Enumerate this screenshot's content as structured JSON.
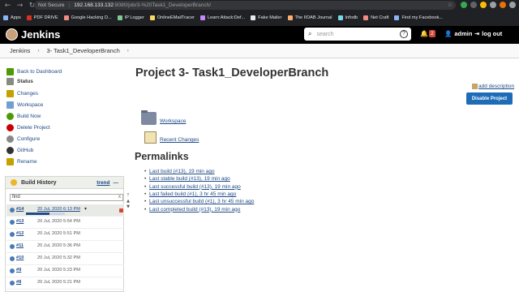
{
  "browser": {
    "security_label": "Not Secure",
    "url_host": "192.168.133.132",
    "url_path": ":8080/job/3-%20Task1_DeveloperBranch/",
    "bookmarks": [
      {
        "label": "Apps",
        "color": "#8ab4f8"
      },
      {
        "label": "PDF DRIVE",
        "color": "#d93025"
      },
      {
        "label": "Google Hacking D...",
        "color": "#f28b82"
      },
      {
        "label": "IP Logger",
        "color": "#81c995"
      },
      {
        "label": "OnlineEMailTracer",
        "color": "#fdd663"
      },
      {
        "label": "Learn:Attack:Def...",
        "color": "#c58af9"
      },
      {
        "label": "Fake Mailer",
        "color": "#e8eaed"
      },
      {
        "label": "The IIOAB Journal",
        "color": "#fcad70"
      },
      {
        "label": "Infodb",
        "color": "#78d9ec"
      },
      {
        "label": "Net Craft",
        "color": "#f28b82"
      },
      {
        "label": "Find my Facebook...",
        "color": "#8ab4f8"
      }
    ]
  },
  "header": {
    "title": "Jenkins",
    "search_placeholder": "search",
    "notifications": "2",
    "user": "admin",
    "logout": "log out"
  },
  "breadcrumb": {
    "root": "Jenkins",
    "current": "3- Task1_DeveloperBranch"
  },
  "tasks": [
    {
      "label": "Back to Dashboard",
      "icon": "arrow-up-icon",
      "color": "#4e9a06"
    },
    {
      "label": "Status",
      "icon": "magnifier-icon",
      "color": "#888a85"
    },
    {
      "label": "Changes",
      "icon": "notepad-icon",
      "color": "#c4a000"
    },
    {
      "label": "Workspace",
      "icon": "folder-icon",
      "color": "#729fcf"
    },
    {
      "label": "Build Now",
      "icon": "clock-icon",
      "color": "#4e9a06"
    },
    {
      "label": "Delete Project",
      "icon": "no-entry-icon",
      "color": "#cc0000"
    },
    {
      "label": "Configure",
      "icon": "gear-icon",
      "color": "#888a85"
    },
    {
      "label": "GitHub",
      "icon": "github-icon",
      "color": "#333333"
    },
    {
      "label": "Rename",
      "icon": "notepad-icon",
      "color": "#c4a000"
    }
  ],
  "build_history": {
    "title": "Build History",
    "trend": "trend",
    "trend_dash": "—",
    "find_placeholder": "find",
    "find_clear": "x",
    "builds": [
      {
        "number": "#14",
        "date": "20 Jul, 2020 6:13 PM",
        "running": true,
        "progress": 0.6
      },
      {
        "number": "#13",
        "date": "20 Jul, 2020 5:54 PM"
      },
      {
        "number": "#12",
        "date": "20 Jul, 2020 5:51 PM"
      },
      {
        "number": "#11",
        "date": "20 Jul, 2020 5:36 PM"
      },
      {
        "number": "#10",
        "date": "20 Jul, 2020 5:32 PM"
      },
      {
        "number": "#9",
        "date": "20 Jul, 2020 5:23 PM"
      },
      {
        "number": "#8",
        "date": "20 Jul, 2020 5:21 PM"
      }
    ]
  },
  "main": {
    "title": "Project 3- Task1_DeveloperBranch",
    "add_description": "add description",
    "disable_button": "Disable Project",
    "workspace_link": "Workspace",
    "recent_changes_link": "Recent Changes",
    "permalinks_title": "Permalinks",
    "permalinks": [
      "Last build (#13), 19 min ago",
      "Last stable build (#13), 19 min ago",
      "Last successful build (#13), 19 min ago",
      "Last failed build (#1), 3 hr 45 min ago",
      "Last unsuccessful build (#1), 3 hr 45 min ago",
      "Last completed build (#13), 19 min ago"
    ]
  }
}
